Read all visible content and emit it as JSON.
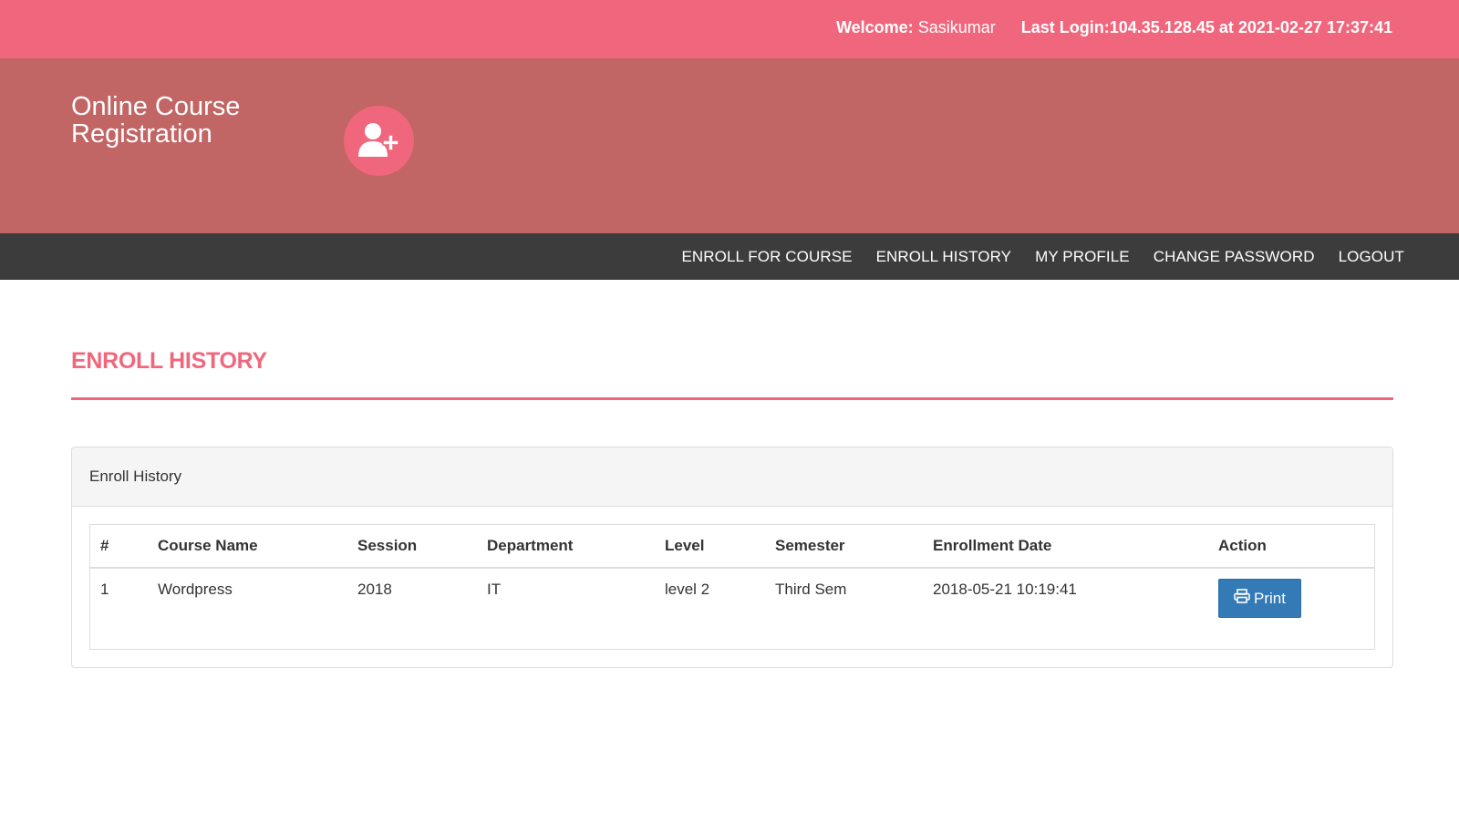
{
  "topbar": {
    "welcome_label": "Welcome:",
    "user_name": "Sasikumar",
    "last_login_label": "Last Login:",
    "last_login_value": "104.35.128.45 at 2021-02-27 17:37:41"
  },
  "header": {
    "logo_line1": "Online Course",
    "logo_line2": "Registration",
    "logo_icon": "user-plus-icon"
  },
  "nav": {
    "items": [
      {
        "label": "ENROLL FOR COURSE"
      },
      {
        "label": "ENROLL HISTORY"
      },
      {
        "label": "MY PROFILE"
      },
      {
        "label": "CHANGE PASSWORD"
      },
      {
        "label": "LOGOUT"
      }
    ]
  },
  "page": {
    "title": "ENROLL HISTORY",
    "accent_color": "#f0677d"
  },
  "panel": {
    "heading": "Enroll History",
    "table": {
      "columns": [
        "#",
        "Course Name",
        "Session",
        "Department",
        "Level",
        "Semester",
        "Enrollment Date",
        "Action"
      ],
      "rows": [
        {
          "num": "1",
          "course": "Wordpress",
          "session": "2018",
          "department": "IT",
          "level": "level 2",
          "semester": "Third Sem",
          "date": "2018-05-21 10:19:41",
          "action_label": "Print",
          "action_icon": "printer-icon"
        }
      ]
    }
  }
}
